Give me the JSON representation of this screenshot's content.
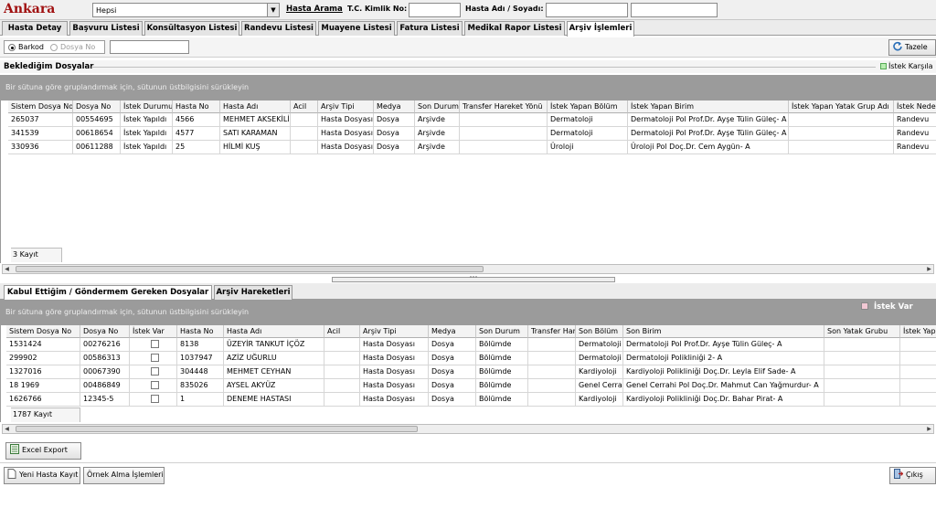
{
  "header": {
    "city": "Ankara",
    "city_select": "Hepsi",
    "hasta_arama": "Hasta Arama",
    "tc_label": "T.C. Kimlik No:",
    "name_label": "Hasta Adı / Soyadı:"
  },
  "tabs": [
    "Hasta Detay",
    "Başvuru Listesi",
    "Konsültasyon Listesi",
    "Randevu Listesi",
    "Muayene Listesi",
    "Fatura Listesi",
    "Medikal Rapor Listesi",
    "Arşiv İşlemleri"
  ],
  "search_mode": {
    "barkod": "Barkod",
    "dosya_no": "Dosya No",
    "tazele": "Tazele"
  },
  "bekledigim": {
    "title": "Beklediğim Dosyalar",
    "legend": "İstek Karşıla",
    "group_hint": "Bir sütuna göre gruplandırmak için, sütunun üstbilgisini sürükleyin",
    "columns": [
      "Sistem Dosya No",
      "Dosya No",
      "İstek Durumu",
      "Hasta No",
      "Hasta Adı",
      "Acil",
      "Arşiv Tipi",
      "Medya",
      "Son Durum",
      "Transfer Hareket Yönü",
      "İstek Yapan Bölüm",
      "İstek Yapan Birim",
      "İstek Yapan Yatak Grup Adı",
      "İstek Nedeni"
    ],
    "rows": [
      [
        "265037",
        "00554695",
        "İstek Yapıldı",
        "4566",
        "MEHMET AKSEKİLİ",
        "",
        "Hasta Dosyası",
        "Dosya",
        "Arşivde",
        "",
        "Dermatoloji",
        "Dermatoloji Pol Prof.Dr. Ayşe Tülin Güleç- A",
        "",
        "Randevu"
      ],
      [
        "341539",
        "00618654",
        "İstek Yapıldı",
        "4577",
        "SATI KARAMAN",
        "",
        "Hasta Dosyası",
        "Dosya",
        "Arşivde",
        "",
        "Dermatoloji",
        "Dermatoloji Pol Prof.Dr. Ayşe Tülin Güleç- A",
        "",
        "Randevu"
      ],
      [
        "330936",
        "00611288",
        "İstek Yapıldı",
        "25",
        "HİLMİ KUŞ",
        "",
        "Hasta Dosyası",
        "Dosya",
        "Arşivde",
        "",
        "Üroloji",
        "Üroloji Pol Doç.Dr. Cem Aygün- A",
        "",
        "Randevu"
      ]
    ],
    "count": "3 Kayıt"
  },
  "lower_tabs": [
    "Kabul Ettiğim / Göndermem Gereken Dosyalar",
    "Arşiv Hareketleri"
  ],
  "kabul": {
    "legend": "İstek Var",
    "group_hint": "Bir sütuna göre gruplandırmak için, sütunun üstbilgisini sürükleyin",
    "columns": [
      "Sistem Dosya No",
      "Dosya No",
      "İstek Var",
      "Hasta No",
      "Hasta Adı",
      "Acil",
      "Arşiv Tipi",
      "Medya",
      "Son Durum",
      "Transfer Hareket Yönü",
      "Son Bölüm",
      "Son Birim",
      "Son Yatak Grubu",
      "İstek Yapan"
    ],
    "rows": [
      [
        "1531424",
        "00276216",
        "",
        "8138",
        "ÜZEYİR TANKUT İÇÖZ",
        "",
        "Hasta Dosyası",
        "Dosya",
        "Bölümde",
        "",
        "Dermatoloji",
        "Dermatoloji Pol Prof.Dr. Ayşe Tülin Güleç- A",
        "",
        ""
      ],
      [
        "299902",
        "00586313",
        "",
        "1037947",
        "AZİZ UĞURLU",
        "",
        "Hasta Dosyası",
        "Dosya",
        "Bölümde",
        "",
        "Dermatoloji",
        "Dermatoloji Polikliniği 2- A",
        "",
        ""
      ],
      [
        "1327016",
        "00067390",
        "",
        "304448",
        "MEHMET CEYHAN",
        "",
        "Hasta Dosyası",
        "Dosya",
        "Bölümde",
        "",
        "Kardiyoloji",
        "Kardiyoloji Polikliniği Doç.Dr. Leyla Elif Sade- A",
        "",
        ""
      ],
      [
        "18 1969",
        "00486849",
        "",
        "835026",
        "AYSEL AKYÜZ",
        "",
        "Hasta Dosyası",
        "Dosya",
        "Bölümde",
        "",
        "Genel Cerrahi",
        "Genel Cerrahi Pol Doç.Dr. Mahmut Can Yağmurdur- A",
        "",
        ""
      ],
      [
        "1626766",
        "12345-5",
        "",
        "1",
        "DENEME HASTASI",
        "",
        "Hasta Dosyası",
        "Dosya",
        "Bölümde",
        "",
        "Kardiyoloji",
        "Kardiyoloji Polikliniği Doç.Dr. Bahar Pirat- A",
        "",
        ""
      ]
    ],
    "count": "1787 Kayıt"
  },
  "buttons": {
    "excel": "Excel Export",
    "yeni_hasta": "Yeni Hasta Kayıt",
    "ornek_alma": "Örnek Alma İşlemleri",
    "cikis": "Çıkış"
  }
}
